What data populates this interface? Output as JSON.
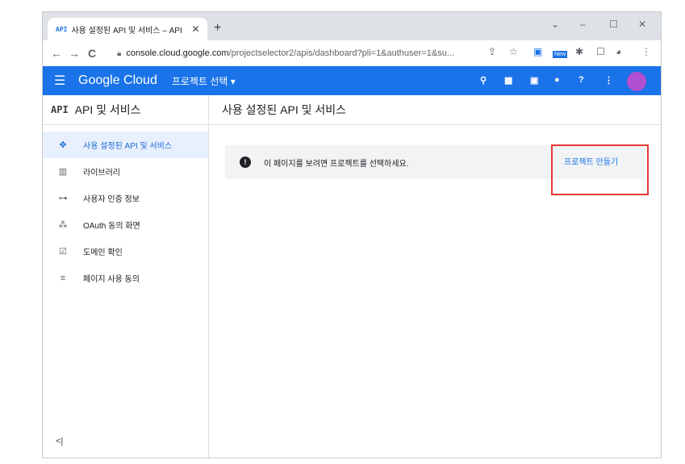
{
  "browser": {
    "tab": {
      "favicon": "API",
      "title": "사용 설정된 API 및 서비스 – API",
      "close": "✕"
    },
    "new_tab": "+",
    "window_controls": {
      "dropdown": "⌄",
      "minimize": "–",
      "maximize": "☐",
      "close": "✕"
    },
    "nav": {
      "back": "←",
      "forward": "→",
      "reload": "C"
    },
    "address": {
      "host": "console.cloud.google.com",
      "path": "/projectselector2/apis/dashboard?pli=1&authuser=1&su..."
    },
    "extensions": [
      "share-icon",
      "star-icon",
      "translate-icon",
      "new-badge-icon",
      "puzzle-icon",
      "sidepanel-icon",
      "profile-icon",
      "menu-dots-icon"
    ],
    "new_badge": "New"
  },
  "gcp_header": {
    "brand": "Google Cloud",
    "project_selector": "프로젝트 선택",
    "icons": [
      "search-icon",
      "gift-icon",
      "terminal-icon",
      "notifications-icon",
      "help-icon",
      "more-icon"
    ],
    "avatar_color": "#b04fd0",
    "bar_color": "#1a73e8"
  },
  "sidebar": {
    "icon": "API",
    "title": "API 및 서비스",
    "items": [
      {
        "label": "사용 설정된 API 및 서비스",
        "icon": "✥",
        "active": true
      },
      {
        "label": "라이브러리",
        "icon": "▥",
        "active": false
      },
      {
        "label": "사용자 인증 정보",
        "icon": "⊶",
        "active": false
      },
      {
        "label": "OAuth 동의 화면",
        "icon": "⁂",
        "active": false
      },
      {
        "label": "도메인 확인",
        "icon": "☑",
        "active": false
      },
      {
        "label": "페이지 사용 동의",
        "icon": "≡",
        "active": false
      }
    ],
    "collapse": "<|"
  },
  "main": {
    "title": "사용 설정된 API 및 서비스",
    "notice": {
      "icon": "!",
      "text": "이 페이지를 보려면 프로젝트를 선택하세요.",
      "action": "프로젝트 만들기"
    }
  }
}
